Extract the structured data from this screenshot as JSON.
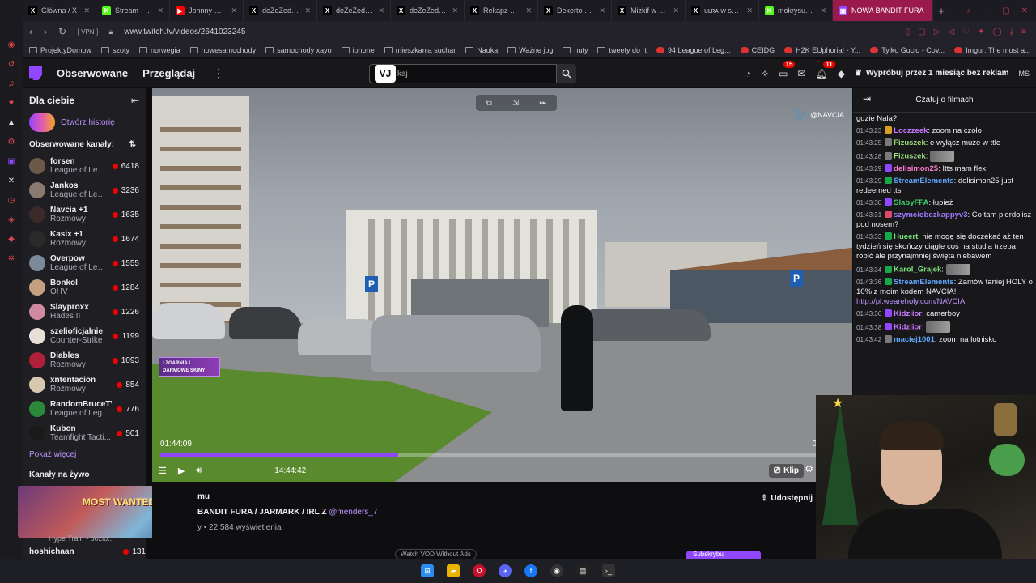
{
  "browser": {
    "tabs": [
      {
        "label": "Główna / X",
        "icon": "x-icon",
        "color": "#000000"
      },
      {
        "label": "Stream - Kick D",
        "icon": "kick-icon",
        "color": "#53fc18"
      },
      {
        "label": "Johnny Mathis",
        "icon": "youtube-icon",
        "color": "#ff0000"
      },
      {
        "label": "deZeZed w ser",
        "icon": "x-icon",
        "color": "#000000"
      },
      {
        "label": "deZeZed w ser",
        "icon": "x-icon",
        "color": "#000000"
      },
      {
        "label": "deZeZed w ser",
        "icon": "x-icon",
        "color": "#000000"
      },
      {
        "label": "Rekapz w serwi",
        "icon": "x-icon",
        "color": "#000000"
      },
      {
        "label": "Dexerto w serw",
        "icon": "x-icon",
        "color": "#000000"
      },
      {
        "label": "Mizkif w serwis",
        "icon": "x-icon",
        "color": "#000000"
      },
      {
        "label": "ᴜʟʀᴀ w serwisi",
        "icon": "x-icon",
        "color": "#000000"
      },
      {
        "label": "mokrysuchar St",
        "icon": "kick-icon",
        "color": "#53fc18"
      }
    ],
    "active_tab": "NOWA BANDIT FURA",
    "url": "www.twitch.tv/videos/2641023245",
    "vpn_label": "VPN",
    "bookmarks": [
      "ProjektyDomow",
      "szoty",
      "norwegia",
      "nowesamochody",
      "samochody xayo",
      "iphone",
      "mieszkania suchar",
      "Nauka",
      "Ważne jpg",
      "nuty",
      "tweety do rt",
      "94 League of Leg...",
      "CEIDG",
      "H2K EUphoria! - Y...",
      "Tylko Gucio - Cov...",
      "Imgur: The most a..."
    ]
  },
  "twitch_nav": {
    "following": "Obserwowane",
    "browse": "Przeglądaj",
    "search_placeholder": "kaj",
    "notif_count_1": "15",
    "notif_count_2": "11",
    "promo": "Wypróbuj przez 1 miesiąc bez reklam",
    "user_initials": "MS"
  },
  "sidebar": {
    "title": "Dla ciebie",
    "history": "Otwórz historię",
    "followed_title": "Obserwowane kanały:",
    "channels": [
      {
        "name": "forsen",
        "game": "League of Leg...",
        "viewers": "6418",
        "color": "#6b5a4a"
      },
      {
        "name": "Jankos",
        "game": "League of Leg...",
        "viewers": "3236",
        "color": "#8a7a70"
      },
      {
        "name": "Navcia +1",
        "game": "Rozmowy",
        "viewers": "1635",
        "color": "#3a2a2a"
      },
      {
        "name": "Kasix +1",
        "game": "Rozmowy",
        "viewers": "1674",
        "color": "#2a2a2a"
      },
      {
        "name": "Overpow",
        "game": "League of Leg...",
        "viewers": "1555",
        "color": "#7a8a9a"
      },
      {
        "name": "Bonkol",
        "game": "OHV",
        "viewers": "1284",
        "color": "#c2a080"
      },
      {
        "name": "Slayproxx",
        "game": "Hades II",
        "viewers": "1226",
        "color": "#d08aa0"
      },
      {
        "name": "szelioficjalnie",
        "game": "Counter-Strike",
        "viewers": "1199",
        "color": "#e8e0d8"
      },
      {
        "name": "Diables",
        "game": "Rozmowy",
        "viewers": "1093",
        "color": "#b0203a"
      },
      {
        "name": "xntentacion",
        "game": "Rozmowy",
        "viewers": "854",
        "color": "#d8c8b0"
      },
      {
        "name": "RandomBruceTV",
        "game": "League of Leg...",
        "viewers": "776",
        "color": "#2a8a3a"
      },
      {
        "name": "Kubon_",
        "game": "Teamfight Tacti...",
        "viewers": "501",
        "color": "#1a1a1a"
      }
    ],
    "show_more": "Pokaż więcej",
    "live_channels": "Kanały na żywo",
    "thumb_text": "MOST WANTED",
    "hype": "Hype Train • pozio...",
    "last_channel": {
      "name": "hoshichaan_",
      "viewers": "131"
    }
  },
  "video": {
    "twitter_handle": "@NAVCIA",
    "promo_overlay": "I ZGARNIAJ DARMOWE SKINY",
    "current_time": "01:44:09",
    "duration": "14:44:42",
    "progress": 0.36,
    "clip_label": "Klip",
    "end_time": "0"
  },
  "meta": {
    "line1": "mu",
    "title": "BANDIT FURA / JARMARK / IRL Z",
    "mention": "@menders_7",
    "views": "y • 22 584 wyświetlenia",
    "share": "Udostępnij",
    "watch_vod": "Watch VOD Without Ads",
    "subscribe": "Subskrybuj"
  },
  "chat": {
    "header": "Czatuj o filmach",
    "messages": [
      {
        "ts": "",
        "user": "",
        "color": "#efeff1",
        "text": "gdzie Nala?",
        "badge": ""
      },
      {
        "ts": "01:43:23",
        "user": "Loczzeek",
        "color": "#c97aff",
        "text": "zoom na czoło",
        "badge": "#d8a020"
      },
      {
        "ts": "01:43:25",
        "user": "Fizuszek",
        "color": "#9be37a",
        "text": "e wyłącz muze w ttle",
        "badge": "#7a7a7a"
      },
      {
        "ts": "01:43:28",
        "user": "Fizuszek",
        "color": "#9be37a",
        "text": "",
        "badge": "#7a7a7a"
      },
      {
        "ts": "01:43:29",
        "user": "delisimon25",
        "color": "#ff7ad0",
        "text": "Itts mam flex",
        "badge": "#9147ff"
      },
      {
        "ts": "01:43:29",
        "user": "StreamElements",
        "color": "#5fa8ff",
        "text": "delisimon25 just redeemed tts",
        "badge": "#18a84a"
      },
      {
        "ts": "01:43:30",
        "user": "SlabyFFA",
        "color": "#3fcf6a",
        "text": "łupież",
        "badge": "#9147ff"
      },
      {
        "ts": "01:43:31",
        "user": "szymciobezkappyv3",
        "color": "#a07aff",
        "text": "Co tam pierdolisz pod nosem?",
        "badge": "#e04a6a"
      },
      {
        "ts": "01:43:33",
        "user": "Hueert",
        "color": "#7adf7a",
        "text": "nie mogę się doczekać aż ten tydzień się skończy ciągle coś na studia trzeba robić ale przynajmniej święta niebawem",
        "badge": "#18a84a"
      },
      {
        "ts": "01:43:34",
        "user": "Karol_Grajek",
        "color": "#7adf7a",
        "text": "",
        "badge": "#18a84a"
      },
      {
        "ts": "01:43:36",
        "user": "StreamElements",
        "color": "#5fa8ff",
        "text": "Zamów taniej HOLY o 10% z moim kodem NAVCIA!",
        "badge": "#18a84a",
        "link": "http://pl.weareholy.com/NAVCIA"
      },
      {
        "ts": "01:43:36",
        "user": "Kidziior",
        "color": "#c97aff",
        "text": "camerboy",
        "badge": "#9147ff"
      },
      {
        "ts": "01:43:38",
        "user": "Kidziior",
        "color": "#c97aff",
        "text": "",
        "badge": "#9147ff"
      },
      {
        "ts": "01:43:42",
        "user": "maciej1001",
        "color": "#5fa8ff",
        "text": "zoom na lotnisko",
        "badge": "#7a7a7a"
      }
    ]
  },
  "colors": {
    "accent": "#9147ff",
    "live": "#eb0400",
    "link": "#bf94ff"
  }
}
